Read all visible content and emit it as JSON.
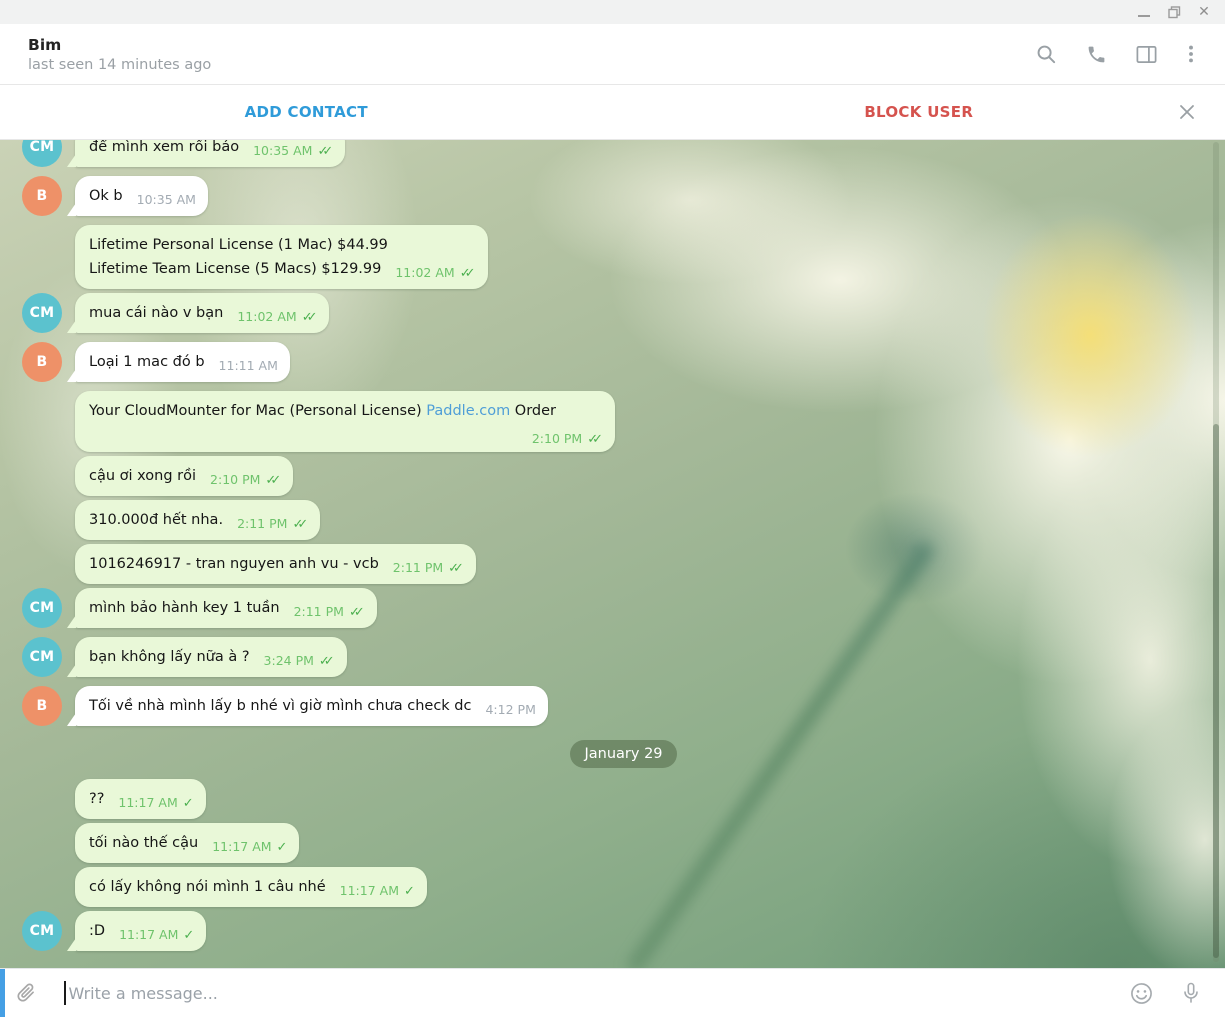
{
  "header": {
    "name": "Bim",
    "status": "last seen 14 minutes ago"
  },
  "contact_bar": {
    "add_contact": "ADD CONTACT",
    "block_user": "BLOCK USER"
  },
  "composer": {
    "placeholder": "Write a message..."
  },
  "icons": {
    "titlebar": [
      "minimize-icon",
      "restore-icon",
      "close-icon"
    ],
    "header": [
      "search-icon",
      "phone-icon",
      "columns-icon",
      "kebab-menu-icon"
    ],
    "contact_bar": [
      "close-icon"
    ],
    "composer": [
      "paperclip-icon",
      "smiley-icon",
      "microphone-icon"
    ]
  },
  "colors": {
    "accent_blue": "#2f9bd9",
    "danger_red": "#d5534e",
    "bubble_out": "#e9f8d8",
    "bubble_in": "#ffffff",
    "avatar_cm": "#5bc2ce",
    "avatar_b": "#ee9168",
    "link": "#4f9ed7",
    "time_out": "#6fc36c",
    "tick_green": "#4db050",
    "time_in": "#a3abb3",
    "composer_strip": "#459fe4"
  },
  "chat": {
    "items": [
      {
        "kind": "message",
        "side": "out",
        "avatar": "CM",
        "tail": true,
        "clipped": true,
        "segments": [
          {
            "type": "text",
            "value": "để mình xem rồi báo"
          }
        ],
        "time": "10:35 AM",
        "ticks": "double"
      },
      {
        "kind": "message",
        "side": "in",
        "avatar": "B",
        "tail": true,
        "segments": [
          {
            "type": "text",
            "value": "Ok b"
          }
        ],
        "time": "10:35 AM",
        "ticks": null
      },
      {
        "kind": "message",
        "side": "out",
        "avatar": null,
        "tail": false,
        "segments": [
          {
            "type": "text",
            "value": "Lifetime Personal License (1 Mac) $44.99"
          },
          {
            "type": "br"
          },
          {
            "type": "text",
            "value": " Lifetime Team License (5 Macs) $129.99"
          }
        ],
        "time": "11:02 AM",
        "ticks": "double"
      },
      {
        "kind": "message",
        "side": "out",
        "avatar": "CM",
        "tail": true,
        "segments": [
          {
            "type": "text",
            "value": "mua cái nào v bạn"
          }
        ],
        "time": "11:02 AM",
        "ticks": "double"
      },
      {
        "kind": "message",
        "side": "in",
        "avatar": "B",
        "tail": true,
        "segments": [
          {
            "type": "text",
            "value": "Loại 1 mac đó b"
          }
        ],
        "time": "11:11 AM",
        "ticks": null
      },
      {
        "kind": "message",
        "side": "out",
        "avatar": null,
        "tail": false,
        "segments": [
          {
            "type": "text",
            "value": "Your CloudMounter for Mac (Personal License) "
          },
          {
            "type": "link",
            "value": "Paddle.com"
          },
          {
            "type": "text",
            "value": " Order"
          }
        ],
        "time": "2:10 PM",
        "ticks": "double"
      },
      {
        "kind": "message",
        "side": "out",
        "avatar": null,
        "tail": false,
        "segments": [
          {
            "type": "text",
            "value": "cậu ơi xong rồi"
          }
        ],
        "time": "2:10 PM",
        "ticks": "double"
      },
      {
        "kind": "message",
        "side": "out",
        "avatar": null,
        "tail": false,
        "segments": [
          {
            "type": "text",
            "value": "310.000đ hết nha."
          }
        ],
        "time": "2:11 PM",
        "ticks": "double"
      },
      {
        "kind": "message",
        "side": "out",
        "avatar": null,
        "tail": false,
        "segments": [
          {
            "type": "text",
            "value": "1016246917 - tran nguyen anh vu - vcb"
          }
        ],
        "time": "2:11 PM",
        "ticks": "double"
      },
      {
        "kind": "message",
        "side": "out",
        "avatar": "CM",
        "tail": true,
        "segments": [
          {
            "type": "text",
            "value": "mình bảo hành key 1 tuần"
          }
        ],
        "time": "2:11 PM",
        "ticks": "double"
      },
      {
        "kind": "message",
        "side": "out",
        "avatar": "CM",
        "tail": true,
        "segments": [
          {
            "type": "text",
            "value": "bạn không lấy nữa à ?"
          }
        ],
        "time": "3:24 PM",
        "ticks": "double"
      },
      {
        "kind": "message",
        "side": "in",
        "avatar": "B",
        "tail": true,
        "segments": [
          {
            "type": "text",
            "value": "Tối về nhà mình lấy b nhé vì giờ mình chưa check dc"
          }
        ],
        "time": "4:12 PM",
        "ticks": null
      },
      {
        "kind": "date",
        "label": "January 29"
      },
      {
        "kind": "message",
        "side": "out",
        "avatar": null,
        "tail": false,
        "segments": [
          {
            "type": "text",
            "value": "??"
          }
        ],
        "time": "11:17 AM",
        "ticks": "single"
      },
      {
        "kind": "message",
        "side": "out",
        "avatar": null,
        "tail": false,
        "segments": [
          {
            "type": "text",
            "value": "tối nào thế cậu"
          }
        ],
        "time": "11:17 AM",
        "ticks": "single"
      },
      {
        "kind": "message",
        "side": "out",
        "avatar": null,
        "tail": false,
        "segments": [
          {
            "type": "text",
            "value": "có lấy không nói mình 1 câu  nhé"
          }
        ],
        "time": "11:17 AM",
        "ticks": "single"
      },
      {
        "kind": "message",
        "side": "out",
        "avatar": "CM",
        "tail": true,
        "segments": [
          {
            "type": "text",
            "value": ":D"
          }
        ],
        "time": "11:17 AM",
        "ticks": "single"
      }
    ]
  }
}
